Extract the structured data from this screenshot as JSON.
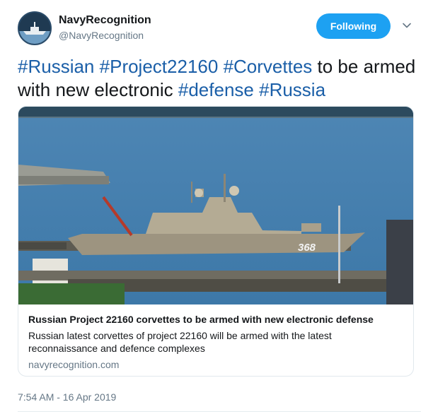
{
  "account": {
    "display_name": "NavyRecognition",
    "handle": "@NavyRecognition",
    "follow_label": "Following"
  },
  "tweet": {
    "segments": [
      {
        "text": "#Russian",
        "hashtag": true
      },
      {
        "text": " ",
        "hashtag": false
      },
      {
        "text": "#Project22160",
        "hashtag": true
      },
      {
        "text": " ",
        "hashtag": false
      },
      {
        "text": "#Corvettes",
        "hashtag": true
      },
      {
        "text": " to be armed with new electronic ",
        "hashtag": false
      },
      {
        "text": "#defense",
        "hashtag": true
      },
      {
        "text": " ",
        "hashtag": false
      },
      {
        "text": "#Russia",
        "hashtag": true
      }
    ],
    "timestamp": "7:54 AM - 16 Apr 2019"
  },
  "card": {
    "title": "Russian Project 22160 corvettes to be armed with new electronic defense",
    "description": "Russian latest corvettes of project 22160 will be armed with the latest reconnaissance and defence complexes",
    "domain": "navyrecognition.com",
    "hull_number": "368"
  },
  "colors": {
    "accent": "#1da1f2",
    "hashtag": "#1b5fa8",
    "muted": "#657786"
  },
  "icons": {
    "avatar": "navy-ship-logo",
    "caret": "chevron-down-icon"
  }
}
